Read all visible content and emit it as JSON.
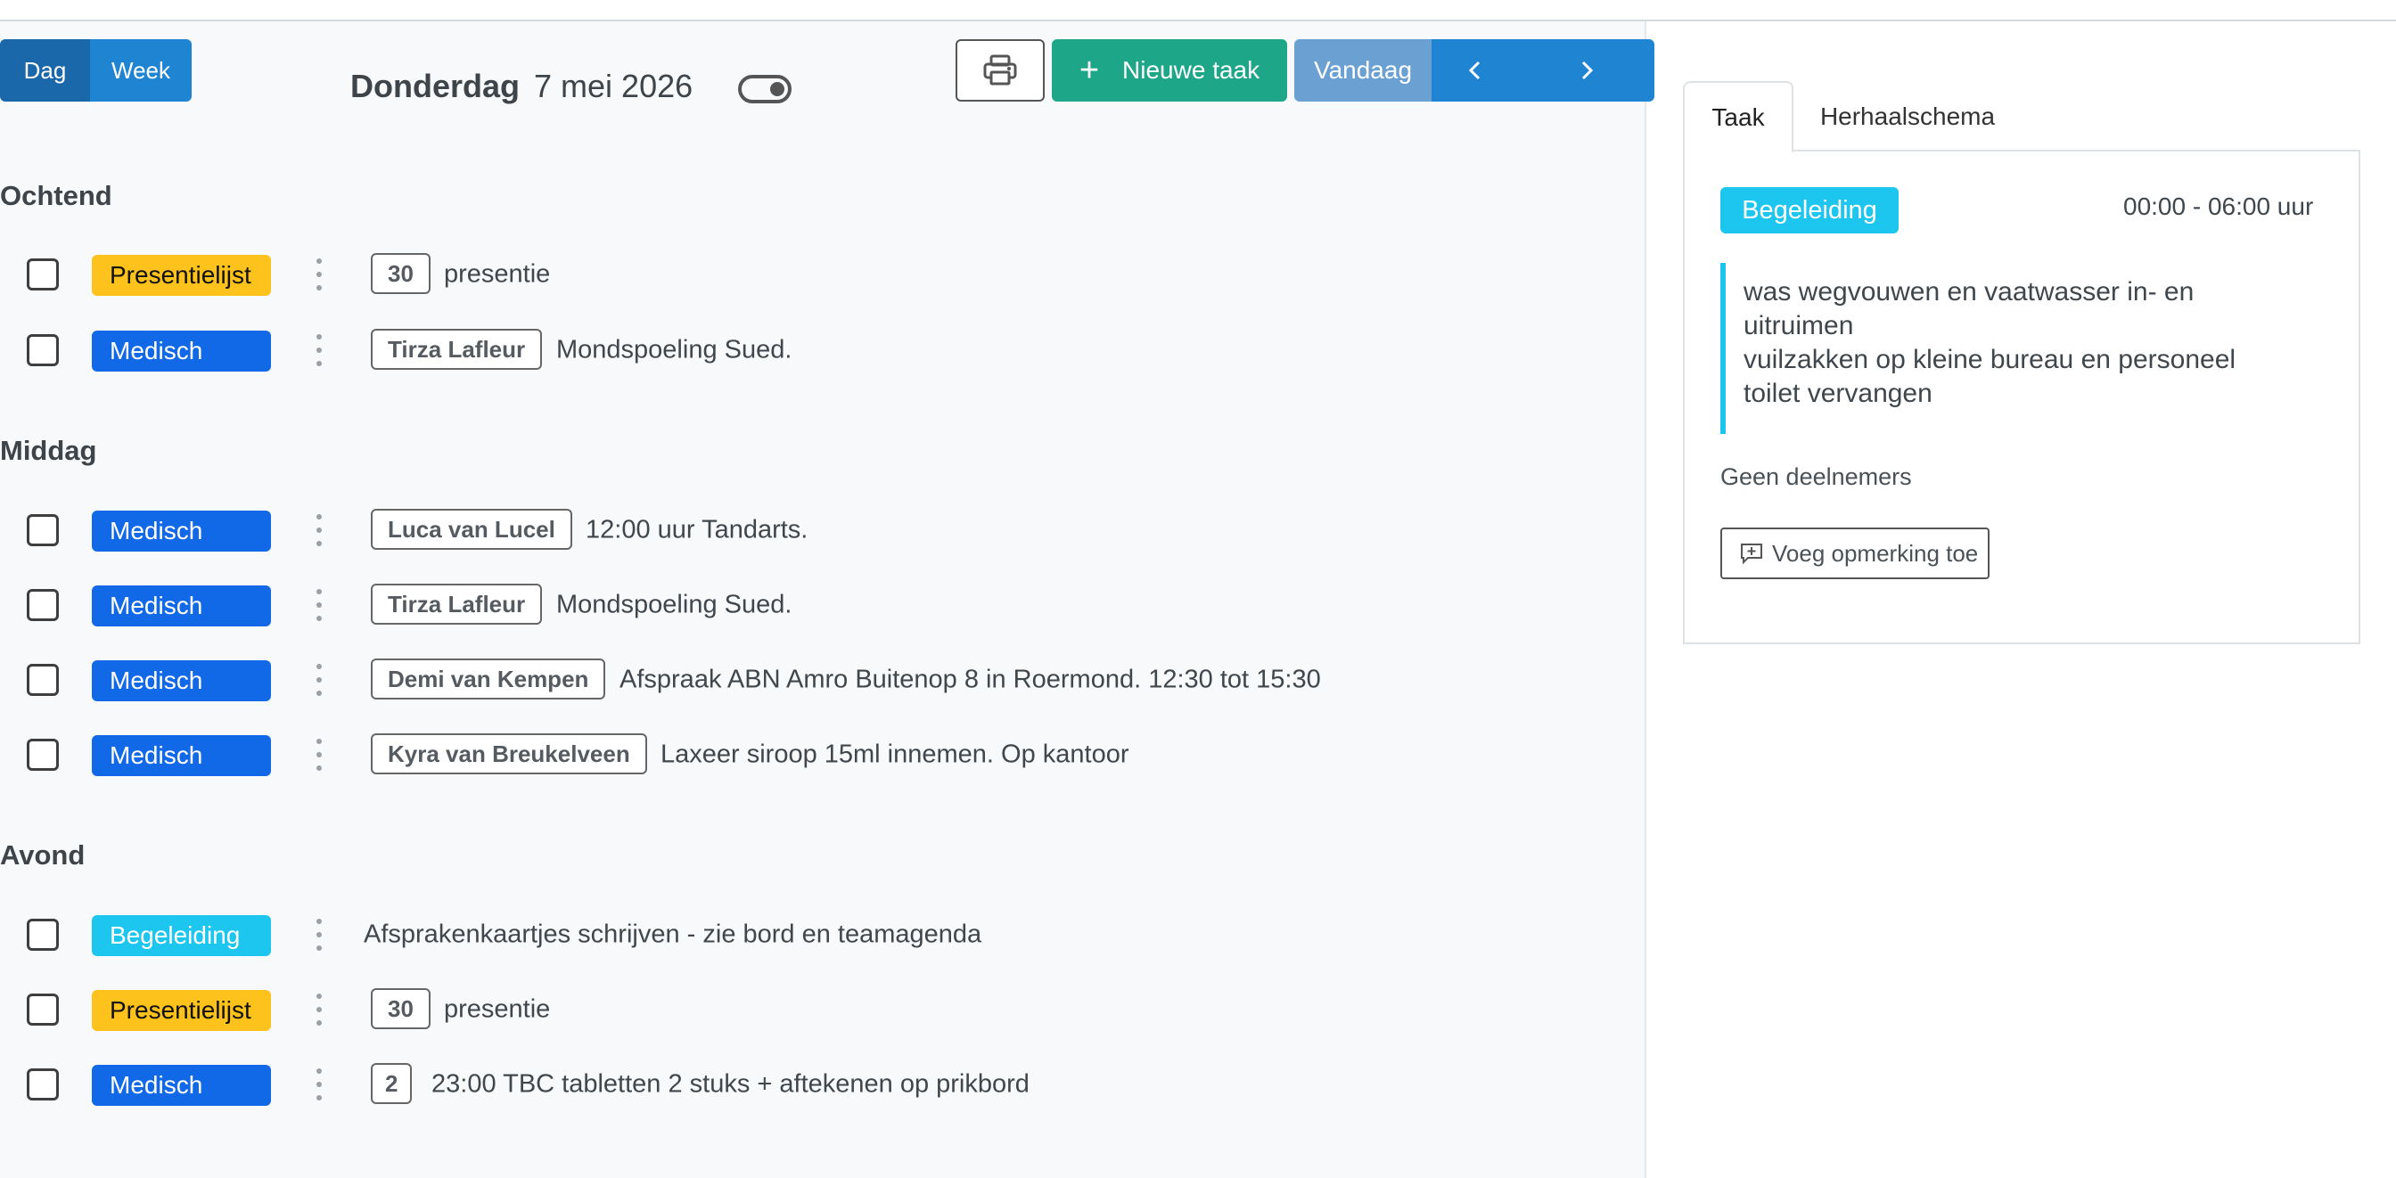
{
  "header": {
    "view_day": "Dag",
    "view_week": "Week",
    "weekday": "Donderdag",
    "date": "7 mei 2026",
    "new_task_label": "Nieuwe taak",
    "today_label": "Vandaag"
  },
  "sections": [
    {
      "title": "Ochtend",
      "rows": [
        {
          "category": "Presentielijst",
          "tag": "30",
          "text": "presentie"
        },
        {
          "category": "Medisch",
          "tag": "Tirza Lafleur",
          "text": "Mondspoeling Sued."
        }
      ]
    },
    {
      "title": "Middag",
      "rows": [
        {
          "category": "Medisch",
          "tag": "Luca van Lucel",
          "text": "12:00 uur Tandarts."
        },
        {
          "category": "Medisch",
          "tag": "Tirza Lafleur",
          "text": "Mondspoeling Sued."
        },
        {
          "category": "Medisch",
          "tag": "Demi van Kempen",
          "text": "Afspraak ABN Amro Buitenop 8 in Roermond. 12:30 tot 15:30"
        },
        {
          "category": "Medisch",
          "tag": "Kyra van Breukelveen",
          "text": "Laxeer siroop 15ml innemen. Op kantoor"
        }
      ]
    },
    {
      "title": "Avond",
      "rows": [
        {
          "category": "Begeleiding",
          "tag": "",
          "text": "Afsprakenkaartjes schrijven - zie bord en teamagenda"
        },
        {
          "category": "Presentielijst",
          "tag": "30",
          "text": "presentie"
        },
        {
          "category": "Medisch",
          "tag": "2",
          "text": "23:00 TBC tabletten 2 stuks + aftekenen op prikbord"
        }
      ]
    }
  ],
  "detail": {
    "tabs": [
      "Taak",
      "Herhaalschema"
    ],
    "category": "Begeleiding",
    "time": "00:00 - 06:00 uur",
    "note_lines": [
      "was wegvouwen en vaatwasser in- en",
      "uitruimen",
      "vuilzakken op kleine bureau en personeel",
      "toilet vervangen"
    ],
    "participants": "Geen deelnemers",
    "add_remark_label": "Voeg opmerking toe"
  },
  "colors": {
    "Medisch": "#1169e8",
    "Presentielijst": "#fdc21b",
    "Begeleiding": "#1dc6ee",
    "primary": "#1f84d2",
    "success": "#1ea688"
  }
}
